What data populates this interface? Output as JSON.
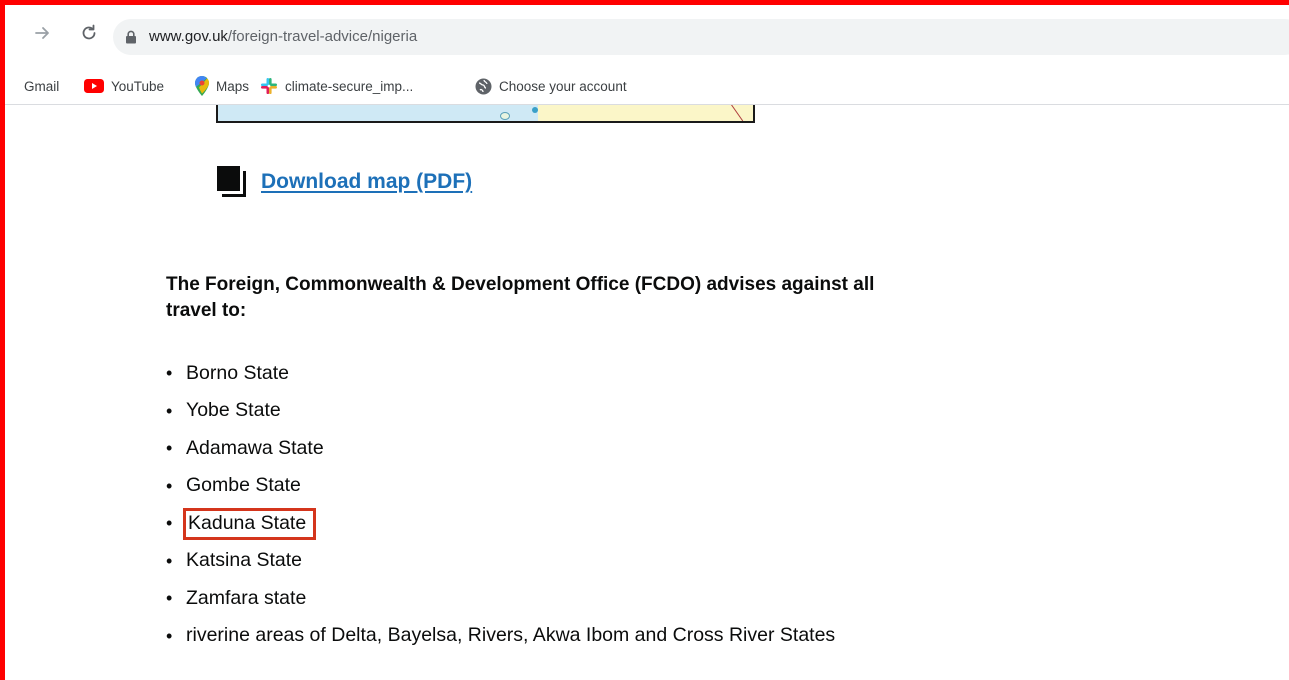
{
  "browser": {
    "url_domain": "www.gov.uk",
    "url_path": "/foreign-travel-advice/nigeria",
    "bookmarks": [
      "Gmail",
      "YouTube",
      "Maps",
      "climate-secure_imp...",
      "Choose your account"
    ]
  },
  "page": {
    "download_label": "Download map (PDF)",
    "advice_heading": "The Foreign, Commonwealth & Development Office (FCDO) advises against all travel to:",
    "states": [
      "Borno State",
      "Yobe State",
      "Adamawa State",
      "Gombe State",
      "Kaduna State",
      "Katsina State",
      "Zamfara state",
      "riverine areas of Delta, Bayelsa, Rivers, Akwa Ibom and Cross River States"
    ],
    "highlighted_state": "Kaduna State"
  },
  "colors": {
    "annotation_frame": "#ff0000",
    "highlight_box": "#d4351c",
    "link": "#1d70b8",
    "text": "#0b0c0c"
  }
}
